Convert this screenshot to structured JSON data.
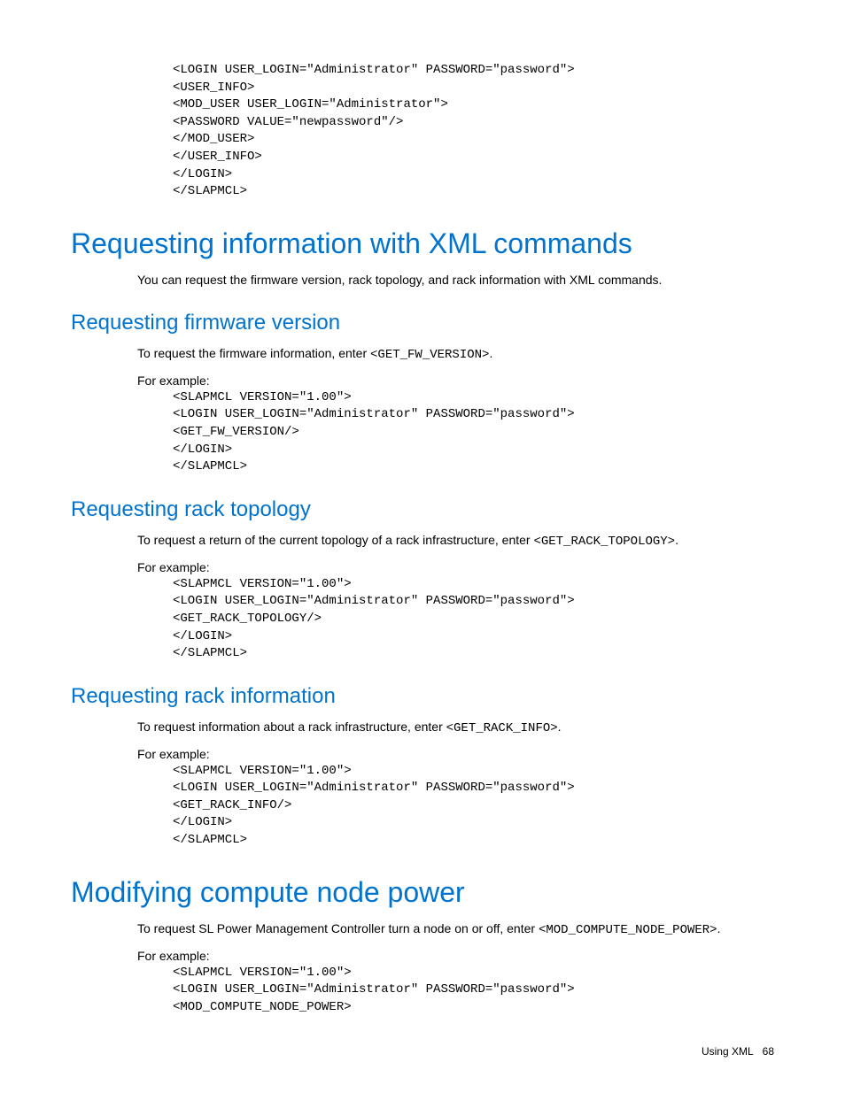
{
  "code_top": "<LOGIN USER_LOGIN=\"Administrator\" PASSWORD=\"password\">\n<USER_INFO>\n<MOD_USER USER_LOGIN=\"Administrator\">\n<PASSWORD VALUE=\"newpassword\"/>\n</MOD_USER>\n</USER_INFO>\n</LOGIN>\n</SLAPMCL>",
  "heading1": "Requesting information with XML commands",
  "para1": "You can request the firmware version, rack topology, and rack information with XML commands.",
  "heading2a": "Requesting firmware version",
  "para2a_pre": "To request the firmware information, enter ",
  "para2a_code": "<GET_FW_VERSION>",
  "para2a_post": ".",
  "for_example": "For example:",
  "code2a": "<SLAPMCL VERSION=\"1.00\">\n<LOGIN USER_LOGIN=\"Administrator\" PASSWORD=\"password\">\n<GET_FW_VERSION/>\n</LOGIN>\n</SLAPMCL>",
  "heading2b": "Requesting rack topology",
  "para2b_pre": "To request a return of the current topology of a rack infrastructure, enter ",
  "para2b_code": "<GET_RACK_TOPOLOGY>",
  "para2b_post": ".",
  "code2b": "<SLAPMCL VERSION=\"1.00\">\n<LOGIN USER_LOGIN=\"Administrator\" PASSWORD=\"password\">\n<GET_RACK_TOPOLOGY/>\n</LOGIN>\n</SLAPMCL>",
  "heading2c": "Requesting rack information",
  "para2c_pre": "To request information about a rack infrastructure, enter ",
  "para2c_code": "<GET_RACK_INFO>",
  "para2c_post": ".",
  "code2c": "<SLAPMCL VERSION=\"1.00\">\n<LOGIN USER_LOGIN=\"Administrator\" PASSWORD=\"password\">\n<GET_RACK_INFO/>\n</LOGIN>\n</SLAPMCL>",
  "heading3": "Modifying compute node power",
  "para3_pre": "To request SL Power Management Controller turn a node on or off, enter ",
  "para3_code": "<MOD_COMPUTE_NODE_POWER>",
  "para3_post": ".",
  "code3": "<SLAPMCL VERSION=\"1.00\">\n<LOGIN USER_LOGIN=\"Administrator\" PASSWORD=\"password\">\n<MOD_COMPUTE_NODE_POWER>",
  "footer_text": "Using XML",
  "footer_page": "68"
}
